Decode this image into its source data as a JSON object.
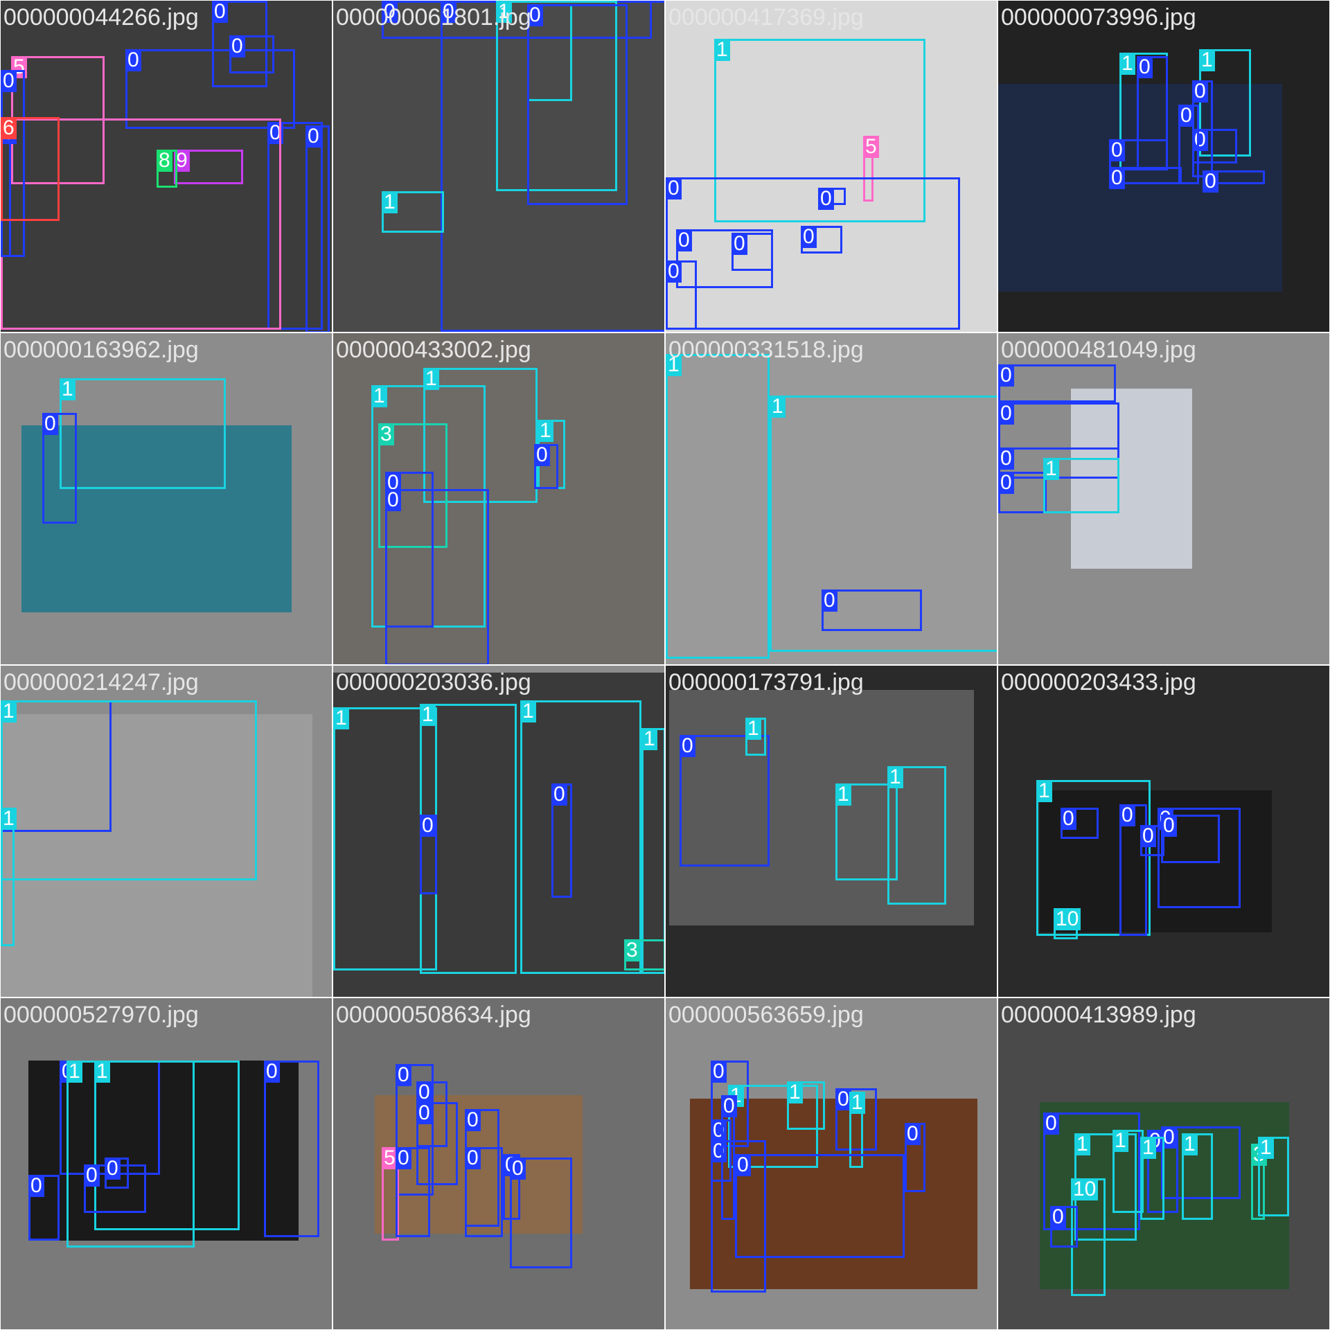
{
  "palette": {
    "class_0": "#1f3bff",
    "class_1": "#19d3e0",
    "class_3": "#19d3b0",
    "class_5": "#ff69c8",
    "class_6": "#ff4040",
    "class_8": "#19e070",
    "class_9": "#c83cf0",
    "class_10": "#19d3e0"
  },
  "tiles": [
    {
      "filename": "000000044266.jpg",
      "bg": "#2a2a2a",
      "photo": "#3c3c3c",
      "boxes": [
        [
          "0",
          "#1f3bff"
        ],
        [
          "5",
          "#ff69c8"
        ],
        [
          "0",
          "#1f3bff"
        ],
        [
          "0",
          "#1f3bff"
        ],
        [
          "0",
          "#1f3bff"
        ],
        [
          "0",
          "#1f3bff"
        ],
        [
          "5",
          "#ff69c8"
        ],
        [
          "9",
          "#c83cf0"
        ],
        [
          "8",
          "#19e070"
        ],
        [
          "0",
          "#1f3bff"
        ],
        [
          "0",
          "#1f3bff"
        ],
        [
          "6",
          "#ff4040"
        ]
      ]
    },
    {
      "filename": "000000061801.jpg",
      "bg": "#8c8c8c",
      "photo": "#4a4a4a",
      "boxes": [
        [
          "0",
          "#1f3bff"
        ],
        [
          "0",
          "#1f3bff"
        ],
        [
          "1",
          "#19d3e0"
        ],
        [
          "1",
          "#19d3e0"
        ],
        [
          "0",
          "#1f3bff"
        ],
        [
          "1",
          "#19d3e0"
        ]
      ]
    },
    {
      "filename": "000000417369.jpg",
      "bg": "#8c8c8c",
      "photo": "#d8d8d8",
      "boxes": [
        [
          "1",
          "#19d3e0"
        ],
        [
          "5",
          "#ff69c8"
        ],
        [
          "0",
          "#1f3bff"
        ],
        [
          "0",
          "#1f3bff"
        ],
        [
          "0",
          "#1f3bff"
        ],
        [
          "0",
          "#1f3bff"
        ],
        [
          "0",
          "#1f3bff"
        ],
        [
          "0",
          "#1f3bff"
        ]
      ]
    },
    {
      "filename": "000000073996.jpg",
      "bg": "#222222",
      "photo": "#1e2a44",
      "boxes": [
        [
          "1",
          "#19d3e0"
        ],
        [
          "0",
          "#1f3bff"
        ],
        [
          "1",
          "#19d3e0"
        ],
        [
          "0",
          "#1f3bff"
        ],
        [
          "0",
          "#1f3bff"
        ],
        [
          "0",
          "#1f3bff"
        ],
        [
          "0",
          "#1f3bff"
        ],
        [
          "0",
          "#1f3bff"
        ],
        [
          "0",
          "#1f3bff"
        ]
      ]
    },
    {
      "filename": "000000163962.jpg",
      "bg": "#8c8c8c",
      "photo": "#2f7a8a",
      "boxes": [
        [
          "1",
          "#19d3e0"
        ],
        [
          "0",
          "#1f3bff"
        ]
      ]
    },
    {
      "filename": "000000433002.jpg",
      "bg": "#6e6e6e",
      "photo": "#6e6a66",
      "boxes": [
        [
          "1",
          "#19d3e0"
        ],
        [
          "1",
          "#19d3e0"
        ],
        [
          "3",
          "#19d3b0"
        ],
        [
          "0",
          "#1f3bff"
        ],
        [
          "0",
          "#1f3bff"
        ],
        [
          "1",
          "#19d3e0"
        ],
        [
          "0",
          "#1f3bff"
        ]
      ]
    },
    {
      "filename": "000000331518.jpg",
      "bg": "#bdbdbd",
      "photo": "#9a9a9a",
      "boxes": [
        [
          "1",
          "#19d3e0"
        ],
        [
          "1",
          "#19d3e0"
        ],
        [
          "0",
          "#1f3bff"
        ]
      ]
    },
    {
      "filename": "000000481049.jpg",
      "bg": "#8c8c8c",
      "photo": "#c8ccd4",
      "boxes": [
        [
          "0",
          "#1f3bff"
        ],
        [
          "0",
          "#1f3bff"
        ],
        [
          "0",
          "#1f3bff"
        ],
        [
          "0",
          "#1f3bff"
        ],
        [
          "1",
          "#19d3e0"
        ]
      ]
    },
    {
      "filename": "000000214247.jpg",
      "bg": "#8c8c8c",
      "photo": "#9c9c9c",
      "boxes": [
        [
          "0",
          "#1f3bff"
        ],
        [
          "1",
          "#19d3e0"
        ],
        [
          "1",
          "#19d3e0"
        ]
      ]
    },
    {
      "filename": "000000203036.jpg",
      "bg": "#8c8c8c",
      "photo": "#3a3a3a",
      "boxes": [
        [
          "1",
          "#19d3e0"
        ],
        [
          "1",
          "#19d3e0"
        ],
        [
          "1",
          "#19d3e0"
        ],
        [
          "1",
          "#19d3e0"
        ],
        [
          "0",
          "#1f3bff"
        ],
        [
          "0",
          "#1f3bff"
        ],
        [
          "3",
          "#19d3b0"
        ]
      ]
    },
    {
      "filename": "000000173791.jpg",
      "bg": "#2a2a2a",
      "photo": "#5a5a5a",
      "boxes": [
        [
          "0",
          "#1f3bff"
        ],
        [
          "1",
          "#19d3e0"
        ],
        [
          "1",
          "#19d3e0"
        ],
        [
          "1",
          "#19d3e0"
        ]
      ]
    },
    {
      "filename": "000000203433.jpg",
      "bg": "#2a2a2a",
      "photo": "#1a1a1a",
      "boxes": [
        [
          "1",
          "#19d3e0"
        ],
        [
          "0",
          "#1f3bff"
        ],
        [
          "0",
          "#1f3bff"
        ],
        [
          "0",
          "#1f3bff"
        ],
        [
          "0",
          "#1f3bff"
        ],
        [
          "0",
          "#1f3bff"
        ],
        [
          "10",
          "#19d3e0"
        ]
      ]
    },
    {
      "filename": "000000527970.jpg",
      "bg": "#7a7a7a",
      "photo": "#1a1a1a",
      "boxes": [
        [
          "0",
          "#1f3bff"
        ],
        [
          "1",
          "#19d3e0"
        ],
        [
          "1",
          "#19d3e0"
        ],
        [
          "0",
          "#1f3bff"
        ],
        [
          "0",
          "#1f3bff"
        ],
        [
          "0",
          "#1f3bff"
        ],
        [
          "0",
          "#1f3bff"
        ]
      ]
    },
    {
      "filename": "000000508634.jpg",
      "bg": "#6e6e6e",
      "photo": "#8a6a4a",
      "boxes": [
        [
          "0",
          "#1f3bff"
        ],
        [
          "0",
          "#1f3bff"
        ],
        [
          "0",
          "#1f3bff"
        ],
        [
          "0",
          "#1f3bff"
        ],
        [
          "5",
          "#ff69c8"
        ],
        [
          "0",
          "#1f3bff"
        ],
        [
          "0",
          "#1f3bff"
        ],
        [
          "0",
          "#1f3bff"
        ],
        [
          "0",
          "#1f3bff"
        ]
      ]
    },
    {
      "filename": "000000563659.jpg",
      "bg": "#8c8c8c",
      "photo": "#6a3a20",
      "boxes": [
        [
          "0",
          "#1f3bff"
        ],
        [
          "1",
          "#19d3e0"
        ],
        [
          "1",
          "#19d3e0"
        ],
        [
          "0",
          "#1f3bff"
        ],
        [
          "1",
          "#19d3e0"
        ],
        [
          "0",
          "#1f3bff"
        ],
        [
          "0",
          "#1f3bff"
        ],
        [
          "0",
          "#1f3bff"
        ],
        [
          "0",
          "#1f3bff"
        ],
        [
          "0",
          "#1f3bff"
        ]
      ]
    },
    {
      "filename": "000000413989.jpg",
      "bg": "#4a4a4a",
      "photo": "#2a5030",
      "boxes": [
        [
          "0",
          "#1f3bff"
        ],
        [
          "1",
          "#19d3e0"
        ],
        [
          "1",
          "#19d3e0"
        ],
        [
          "0",
          "#1f3bff"
        ],
        [
          "0",
          "#1f3bff"
        ],
        [
          "1",
          "#19d3e0"
        ],
        [
          "1",
          "#19d3e0"
        ],
        [
          "10",
          "#19d3e0"
        ],
        [
          "3",
          "#19d3b0"
        ],
        [
          "1",
          "#19d3e0"
        ],
        [
          "0",
          "#1f3bff"
        ]
      ]
    }
  ]
}
